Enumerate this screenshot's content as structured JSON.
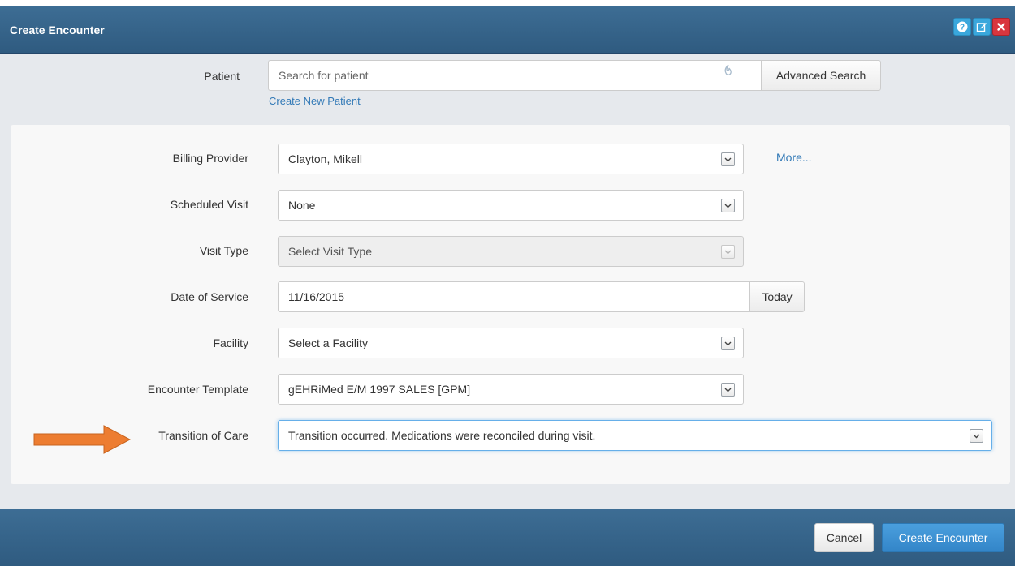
{
  "dialog": {
    "title": "Create Encounter"
  },
  "header_buttons": [
    {
      "icon": "help-icon",
      "color": "#3aa7dc"
    },
    {
      "icon": "edit-icon",
      "color": "#3aa7dc"
    },
    {
      "icon": "close-icon",
      "color": "#d9363e"
    }
  ],
  "patient": {
    "label": "Patient",
    "search_placeholder": "Search for patient",
    "advanced_search_label": "Advanced Search",
    "create_new_label": "Create New Patient"
  },
  "form": {
    "billing_provider": {
      "label": "Billing Provider",
      "value": "Clayton, Mikell",
      "more_label": "More..."
    },
    "scheduled_visit": {
      "label": "Scheduled Visit",
      "value": "None"
    },
    "visit_type": {
      "label": "Visit Type",
      "value": "Select Visit Type",
      "disabled": true
    },
    "date_of_service": {
      "label": "Date of Service",
      "value": "11/16/2015",
      "today_label": "Today"
    },
    "facility": {
      "label": "Facility",
      "value": "Select a Facility"
    },
    "encounter_template": {
      "label": "Encounter Template",
      "value": "gEHRiMed E/M 1997 SALES [GPM]"
    },
    "transition_of_care": {
      "label": "Transition of Care",
      "value": "Transition occurred. Medications were reconciled during visit."
    }
  },
  "footer": {
    "cancel_label": "Cancel",
    "create_label": "Create Encounter"
  },
  "colors": {
    "header": "#2f5b80",
    "link": "#337ab7",
    "primary": "#3385c8",
    "annotation_arrow": "#ed7d31"
  }
}
